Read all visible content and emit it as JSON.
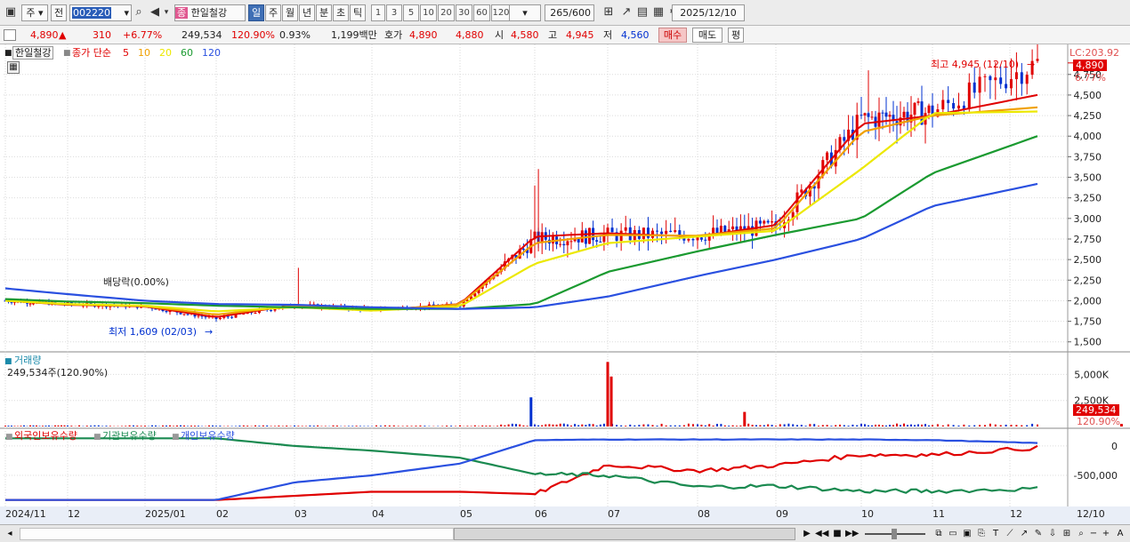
{
  "toolbar": {
    "market_tab": "주",
    "prev_label": "전",
    "code_value": "002220",
    "company_name_badge": "종",
    "company_name": "한일철강",
    "period_tabs": [
      "일",
      "주",
      "월",
      "년",
      "분",
      "초",
      "틱"
    ],
    "period_selected": "일",
    "interval_buttons": [
      "1",
      "3",
      "5",
      "10",
      "20",
      "30",
      "60",
      "120"
    ],
    "count_value": "265",
    "count_total": "/600",
    "date_value": "2025/12/10"
  },
  "quote": {
    "price": "4,890",
    "price_arrow": "▲",
    "change": "310",
    "change_pct": "+6.77%",
    "volume": "249,534",
    "volume_ratio": "120.90%",
    "turnover": "0.93%",
    "amount": "1,199백만",
    "ask_label": "호가",
    "ask": "4,890",
    "bid": "4,880",
    "open_label": "시",
    "open": "4,580",
    "high_label": "고",
    "high": "4,945",
    "low_label": "저",
    "low": "4,560",
    "buy_button": "매수",
    "sell_button": "매도",
    "eval_button": "평"
  },
  "price_pane": {
    "stock_label": "한일철강",
    "ma_title": "종가 단순",
    "ma_periods": [
      "5",
      "10",
      "20",
      "60",
      "120"
    ],
    "ma_colors": [
      "#e00000",
      "#f0a000",
      "#ece800",
      "#1a9a30",
      "#2a50e0"
    ],
    "lc_label": "LC:203.92",
    "price_badge": "4,890",
    "pct_label": "6.77%",
    "high_annotation": "최고 4,945 (12/10)",
    "low_annotation": "최저 1,609 (02/03)",
    "dividend_annotation": "배당락(0.00%)"
  },
  "volume_pane": {
    "title": "거래량",
    "value_label": "249,534주(120.90%)",
    "badge_value": "249,534",
    "badge_pct": "120.90%"
  },
  "holdings_pane": {
    "series_names": [
      "외국인보유수량",
      "기관보유수량",
      "개인보유수량"
    ],
    "series_colors": [
      "#e00000",
      "#1a8a50",
      "#2a50e0"
    ]
  },
  "x_axis": {
    "month_labels": [
      "2024/11",
      "12",
      "2025/01",
      "02",
      "03",
      "04",
      "05",
      "06",
      "07",
      "08",
      "09",
      "10",
      "11",
      "12"
    ],
    "cursor_label": "12/10"
  },
  "chart_data": [
    {
      "type": "candlestick",
      "title": "한일철강",
      "x": [
        "2024/11",
        "2024/12",
        "2025/01",
        "2025/02",
        "2025/03",
        "2025/04",
        "2025/05",
        "2025/06",
        "2025/07",
        "2025/08",
        "2025/09",
        "2025/10",
        "2025/11",
        "2025/12"
      ],
      "close_approx": [
        2000,
        1960,
        1930,
        1780,
        1950,
        1900,
        1950,
        2750,
        2800,
        2800,
        2900,
        4200,
        4300,
        4890
      ],
      "ylim": [
        1400,
        5050
      ],
      "yticks": [
        1500,
        1750,
        2000,
        2250,
        2500,
        2750,
        3000,
        3250,
        3500,
        3750,
        4000,
        4250,
        4500,
        4750
      ],
      "series": [
        {
          "name": "5",
          "values": [
            2000,
            1950,
            1930,
            1800,
            1950,
            1880,
            1960,
            2780,
            2820,
            2780,
            2920,
            4150,
            4250,
            4500
          ]
        },
        {
          "name": "10",
          "values": [
            2000,
            1955,
            1935,
            1830,
            1940,
            1880,
            1955,
            2700,
            2800,
            2790,
            2880,
            4050,
            4250,
            4350
          ]
        },
        {
          "name": "20",
          "values": [
            2000,
            1960,
            1940,
            1870,
            1920,
            1880,
            1930,
            2450,
            2700,
            2780,
            2850,
            3600,
            4280,
            4300
          ]
        },
        {
          "name": "60",
          "values": [
            2020,
            1990,
            1970,
            1940,
            1920,
            1900,
            1900,
            1960,
            2350,
            2600,
            2800,
            3000,
            3550,
            4000
          ]
        },
        {
          "name": "120",
          "values": [
            2150,
            2080,
            2000,
            1960,
            1950,
            1920,
            1900,
            1920,
            2050,
            2300,
            2500,
            2750,
            3150,
            3420
          ]
        }
      ]
    },
    {
      "type": "bar",
      "title": "거래량",
      "ylim": [
        0,
        7000000
      ],
      "yticks": [
        2500000,
        5000000
      ],
      "ytick_labels": [
        "2,500K",
        "5,000K"
      ],
      "peaks": [
        {
          "x": "2025/06",
          "value": 2800000
        },
        {
          "x": "2025/07",
          "value": 6200000
        },
        {
          "x": "2025/07",
          "value": 4800000
        },
        {
          "x": "2025/08",
          "value": 1400000
        },
        {
          "x": "2025/12",
          "value": 249534
        }
      ]
    },
    {
      "type": "line",
      "yticks": [
        0,
        -500000
      ],
      "ytick_labels": [
        "0",
        "-500,000"
      ],
      "series": [
        {
          "name": "외국인보유수량",
          "values": [
            -920000,
            -920000,
            -920000,
            -920000,
            -850000,
            -780000,
            -780000,
            -820000,
            -320000,
            -420000,
            -330000,
            -150000,
            -150000,
            -30000
          ]
        },
        {
          "name": "기관보유수량",
          "values": [
            130000,
            130000,
            130000,
            130000,
            0,
            -80000,
            -200000,
            -480000,
            -500000,
            -700000,
            -680000,
            -770000,
            -770000,
            -730000
          ]
        },
        {
          "name": "개인보유수량",
          "values": [
            -920000,
            -920000,
            -920000,
            -920000,
            -620000,
            -500000,
            -300000,
            100000,
            110000,
            110000,
            110000,
            110000,
            100000,
            50000
          ]
        }
      ]
    }
  ]
}
